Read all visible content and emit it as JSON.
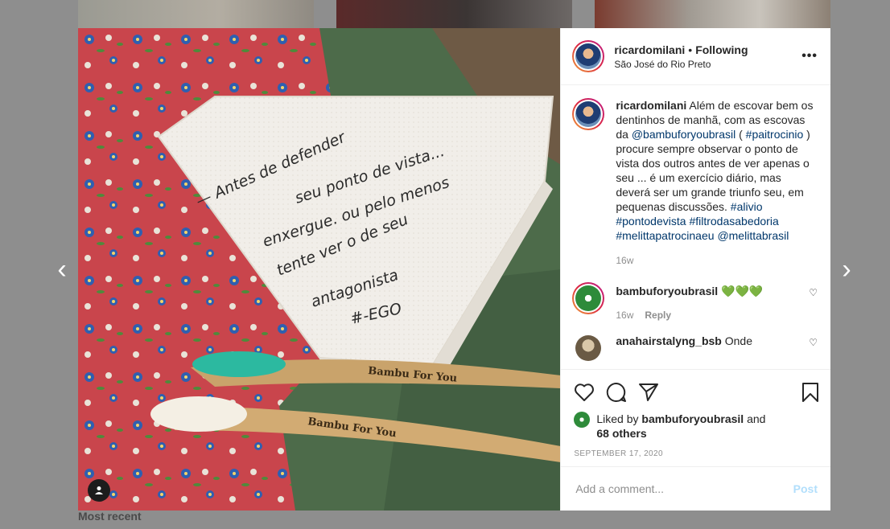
{
  "background": {
    "section_label": "Most recent",
    "prev_arrow": "‹",
    "next_arrow": "›"
  },
  "post": {
    "author": "ricardomilani",
    "follow_status": "Following",
    "location": "São José do Rio Preto",
    "more_label": "•••",
    "image": {
      "note_lines": [
        "— Antes de defender",
        "seu ponto de vista...",
        "enxergue. ou pelo menos",
        "tente ver o de seu",
        "antagonista",
        "#-EGO"
      ],
      "brush_text_1": "Bambu For You",
      "brush_text_2": "Bambu For You"
    },
    "caption": {
      "username": "ricardomilani",
      "text_1": " Além de escovar bem os dentinhos de manhã, com as escovas da ",
      "mention_1": "@bambuforyoubrasil",
      "text_2": " ( ",
      "tag_1": "#paitrocinio",
      "text_3": " ) procure sempre observar o ponto de vista dos outros antes de ver apenas o seu ... é um exercício diário, mas deverá ser um grande triunfo seu, em pequenas discussões. ",
      "tag_2": "#alivio",
      "tag_3": "#pontodevista",
      "tag_4": "#filtrodasabedoria",
      "tag_5": "#melittapatrocinaeu",
      "mention_2": "@melittabrasil",
      "time": "16w"
    },
    "comments": [
      {
        "username": "bambuforyoubrasil",
        "text": "💚💚💚",
        "time": "16w",
        "reply": "Reply"
      },
      {
        "username": "anahairstalyng_bsb",
        "text": " Onde"
      }
    ],
    "likes": {
      "prefix": "Liked by ",
      "by": "bambuforyoubrasil",
      "mid": " and",
      "others": "68 others"
    },
    "date": "SEPTEMBER 17, 2020",
    "add_comment_placeholder": "Add a comment...",
    "post_label": "Post"
  },
  "colors": {
    "link": "#00376b",
    "post_button_disabled": "#b2dffc",
    "hearts": "#2fbf2f"
  }
}
